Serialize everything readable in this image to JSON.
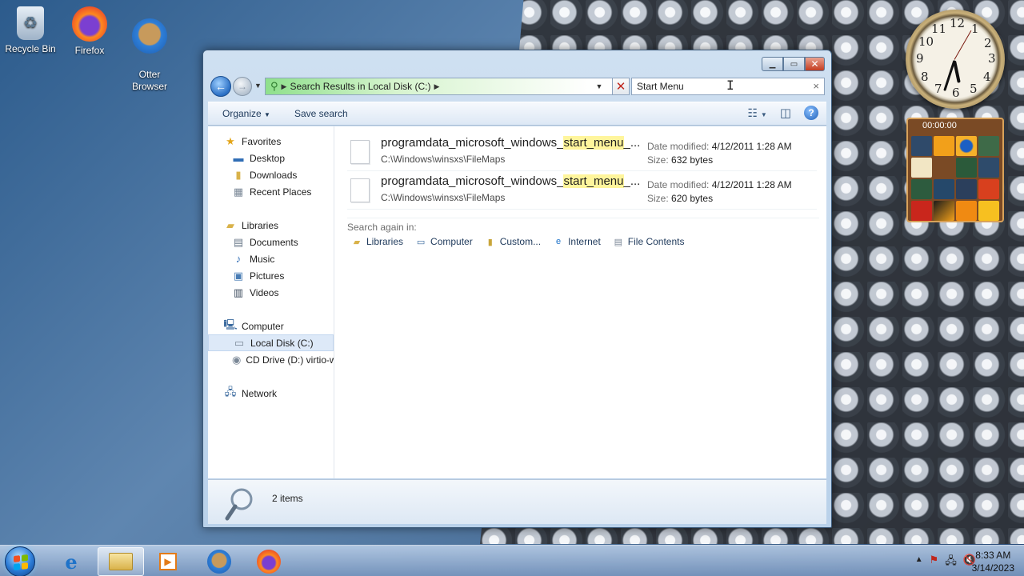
{
  "desktop": {
    "icons": [
      {
        "label": "Recycle Bin",
        "icon": "recycle-bin-icon"
      },
      {
        "label": "Firefox",
        "icon": "firefox-icon"
      },
      {
        "label": "Otter\nBrowser",
        "icon": "otter-browser-icon"
      }
    ]
  },
  "clock_gadget": {
    "numerals": [
      "12",
      "1",
      "2",
      "3",
      "4",
      "5",
      "6",
      "7",
      "8",
      "9",
      "10",
      "11"
    ]
  },
  "puzzle_gadget": {
    "timer": "00:00:00"
  },
  "window": {
    "address": {
      "breadcrumb": "Search Results in Local Disk (C:)"
    },
    "search": {
      "value": "Start Menu"
    },
    "toolbar": {
      "organize_label": "Organize",
      "save_search_label": "Save search"
    },
    "nav_pane": {
      "favorites": {
        "label": "Favorites",
        "items": [
          "Desktop",
          "Downloads",
          "Recent Places"
        ]
      },
      "libraries": {
        "label": "Libraries",
        "items": [
          "Documents",
          "Music",
          "Pictures",
          "Videos"
        ]
      },
      "computer": {
        "label": "Computer",
        "items": [
          "Local Disk (C:)",
          "CD Drive (D:) virtio-w"
        ]
      },
      "network": {
        "label": "Network"
      }
    },
    "results": [
      {
        "name_prefix": "programdata_microsoft_windows_",
        "name_highlight": "start_menu",
        "name_suffix": "_...",
        "path": "C:\\Windows\\winsxs\\FileMaps",
        "date_label": "Date modified:",
        "date": "4/12/2011 1:28 AM",
        "size_label": "Size:",
        "size": "632 bytes"
      },
      {
        "name_prefix": "programdata_microsoft_windows_",
        "name_highlight": "start_menu",
        "name_suffix": "_...",
        "path": "C:\\Windows\\winsxs\\FileMaps",
        "date_label": "Date modified:",
        "date": "4/12/2011 1:28 AM",
        "size_label": "Size:",
        "size": "620 bytes"
      }
    ],
    "search_again": {
      "label": "Search again in:",
      "links": [
        "Libraries",
        "Computer",
        "Custom...",
        "Internet",
        "File Contents"
      ]
    },
    "details": {
      "count": "2 items"
    }
  },
  "taskbar": {
    "time": "8:33 AM",
    "date": "3/14/2023"
  },
  "colors": {
    "highlight": "#fff59c",
    "selected_nav": "#dde9f8",
    "close_button": "#c43c20"
  }
}
